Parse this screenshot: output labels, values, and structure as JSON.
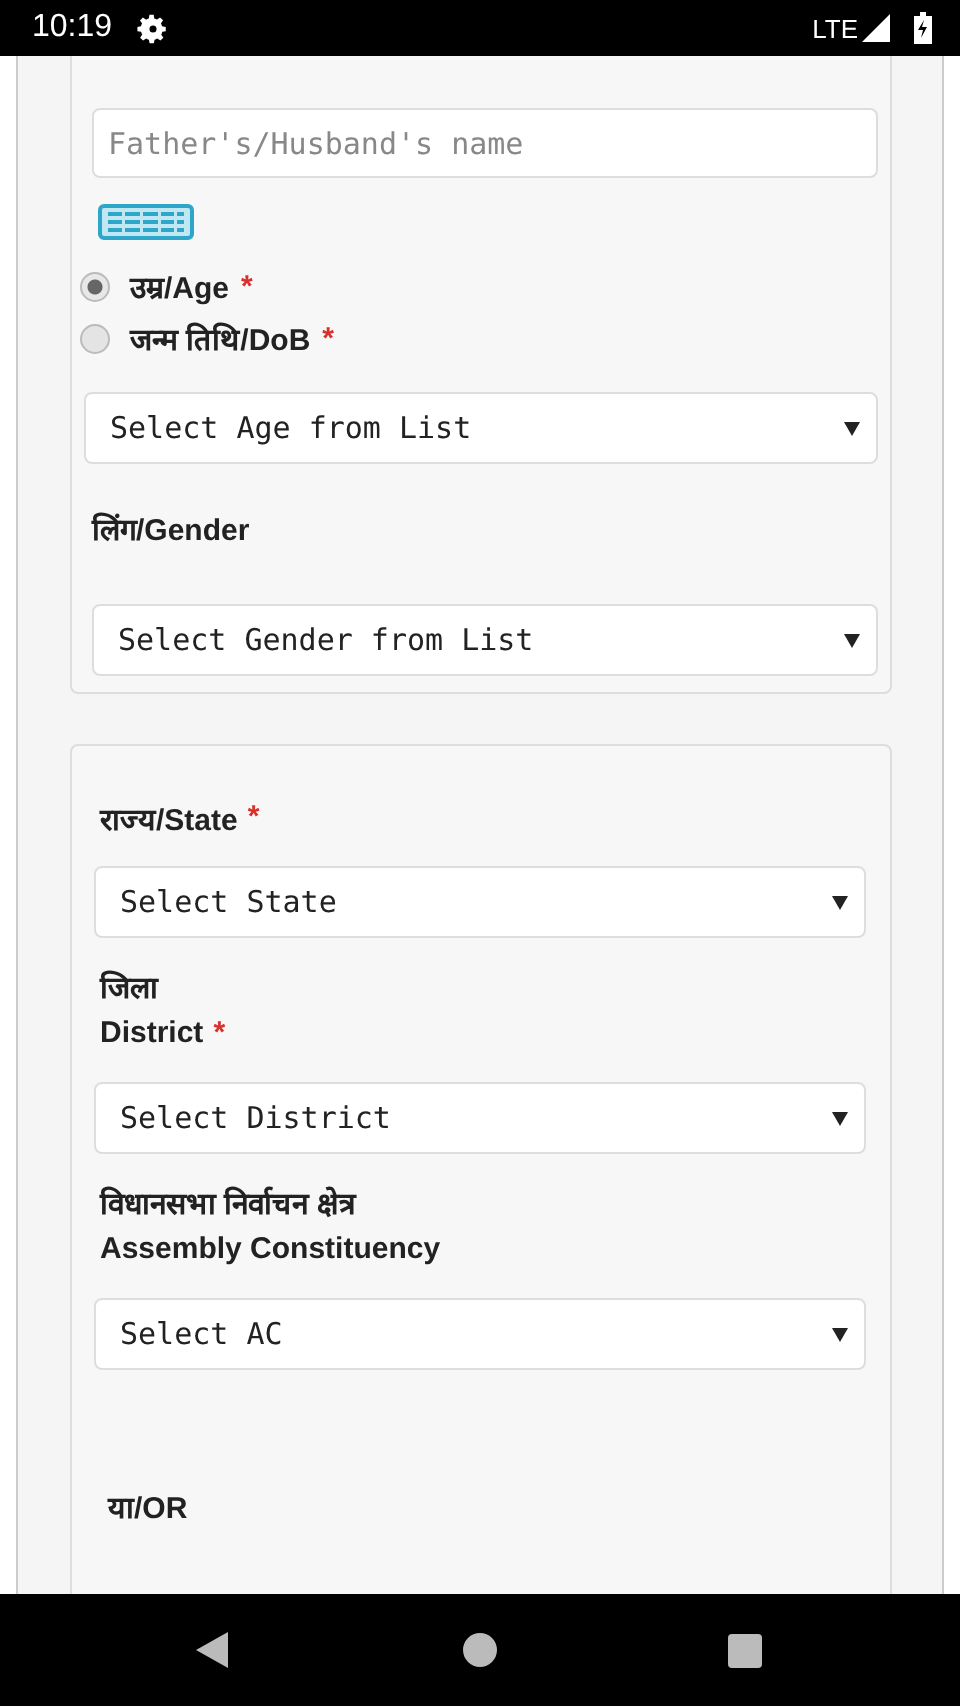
{
  "status_bar": {
    "time": "10:19",
    "network": "LTE"
  },
  "personal_card": {
    "name_field": {
      "placeholder": "Father's/Husband's name"
    },
    "age_options": [
      {
        "label": "उम्र/Age",
        "required_mark": "*",
        "selected": true
      },
      {
        "label": "जन्म तिथि/DoB",
        "required_mark": "*",
        "selected": false
      }
    ],
    "age_select": {
      "value": "Select Age from List"
    },
    "gender_label": "लिंग/Gender",
    "gender_select": {
      "value": "Select Gender from List"
    }
  },
  "location_card": {
    "fields": [
      {
        "label_lines": [
          "राज्य/State"
        ],
        "required_mark": "*",
        "value": "Select State"
      },
      {
        "label_lines": [
          "जिला",
          "District"
        ],
        "required_mark": "*",
        "value": "Select District"
      },
      {
        "label_lines": [
          "विधानसभा निर्वाचन क्षेत्र",
          "Assembly Constituency"
        ],
        "value": "Select AC"
      }
    ],
    "or_label": "या/OR"
  }
}
